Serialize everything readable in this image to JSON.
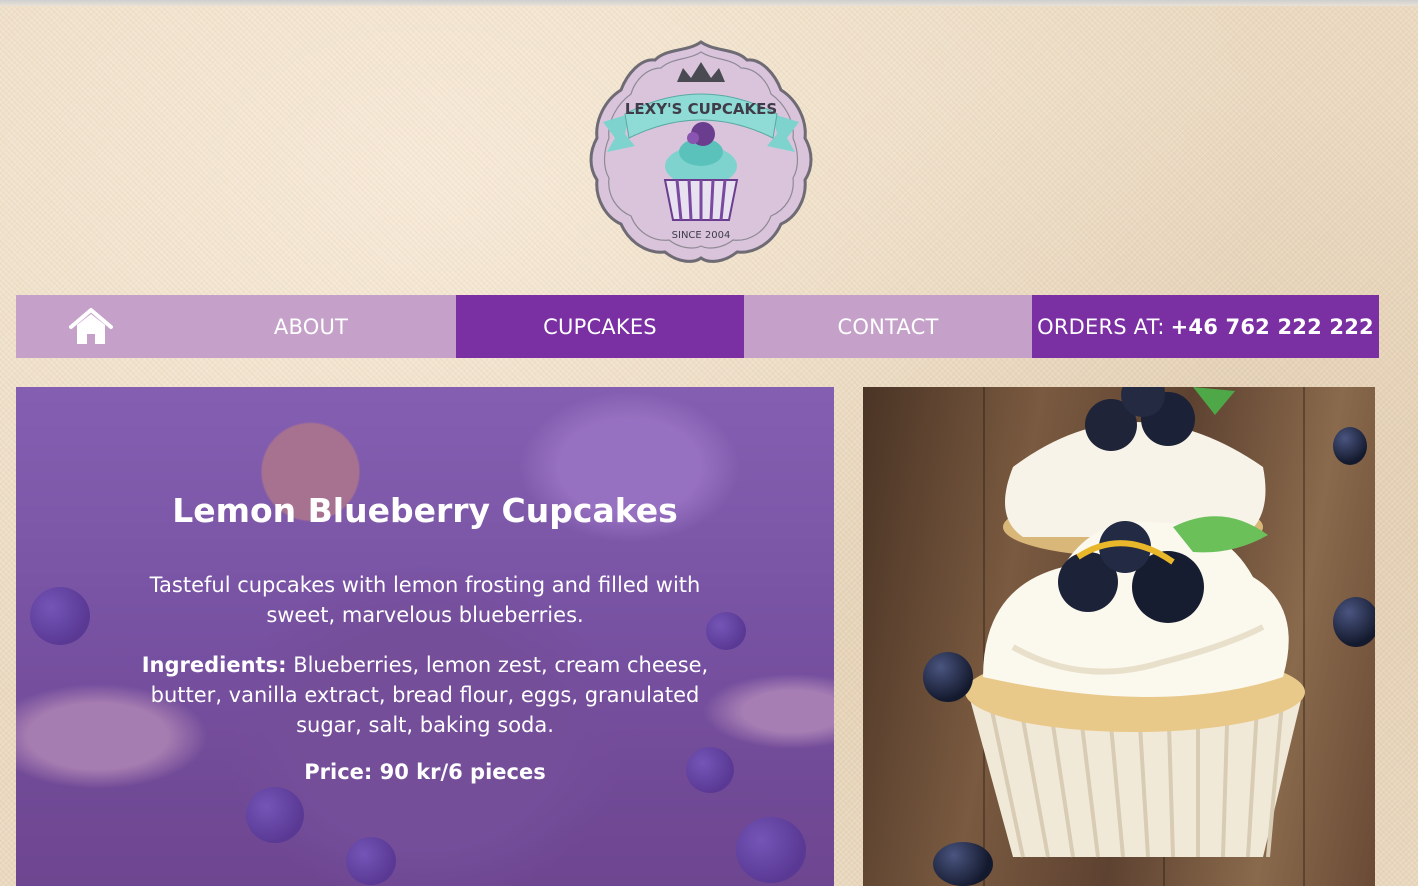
{
  "brand": {
    "name": "LEXY'S CUPCAKES",
    "since": "SINCE 2004",
    "colors": {
      "primary": "#7a2fa3",
      "light": "#c5a1c9",
      "background": "#ead9c0"
    }
  },
  "nav": {
    "home_icon": "home-icon",
    "about": "ABOUT",
    "cupcakes": "CUPCAKES",
    "contact": "CONTACT",
    "orders_label": "ORDERS AT:",
    "orders_phone": "+46 762 222 222",
    "active": "CUPCAKES"
  },
  "product": {
    "title": "Lemon Blueberry Cupcakes",
    "description": "Tasteful cupcakes with lemon frosting and filled with sweet, marvelous blueberries.",
    "ingredients_label": "Ingredients:",
    "ingredients": "Blueberries, lemon zest, cream cheese, butter, vanilla extract, bread flour, eggs, granulated sugar, salt, baking soda.",
    "price": "Price: 90 kr/6 pieces"
  }
}
